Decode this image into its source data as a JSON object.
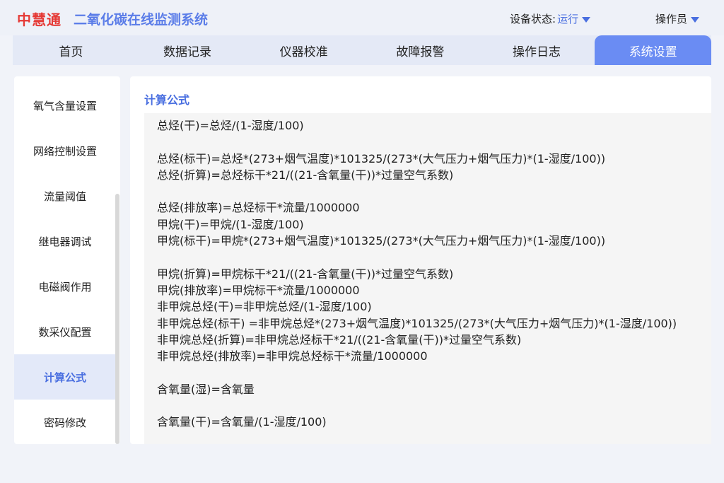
{
  "header": {
    "brand": "中慧通",
    "system_title": "二氧化碳在线监测系统",
    "status_label": "设备状态:",
    "status_value": "运行",
    "operator_label": "操作员"
  },
  "nav": {
    "tabs": [
      {
        "label": "首页"
      },
      {
        "label": "数据记录"
      },
      {
        "label": "仪器校准"
      },
      {
        "label": "故障报警"
      },
      {
        "label": "操作日志"
      },
      {
        "label": "系统设置"
      }
    ],
    "active_index": 5
  },
  "sidebar": {
    "items": [
      {
        "label": "氧气含量设置"
      },
      {
        "label": "网络控制设置"
      },
      {
        "label": "流量阈值"
      },
      {
        "label": "继电器调试"
      },
      {
        "label": "电磁阀作用"
      },
      {
        "label": "数采仪配置"
      },
      {
        "label": "计算公式"
      },
      {
        "label": "密码修改"
      }
    ],
    "active_index": 6
  },
  "main": {
    "section_title": "计算公式",
    "formulas": [
      "总烃(干)=总烃/(1-湿度/100)",
      "",
      "总烃(标干)=总烃*(273+烟气温度)*101325/(273*(大气压力+烟气压力)*(1-湿度/100))",
      "总烃(折算)=总烃标干*21/((21-含氧量(干))*过量空气系数)",
      "",
      "总烃(排放率)=总烃标干*流量/1000000",
      "甲烷(干)=甲烷/(1-湿度/100)",
      "甲烷(标干)=甲烷*(273+烟气温度)*101325/(273*(大气压力+烟气压力)*(1-湿度/100))",
      "",
      "甲烷(折算)=甲烷标干*21/((21-含氧量(干))*过量空气系数)",
      "甲烷(排放率)=甲烷标干*流量/1000000",
      "非甲烷总烃(干)=非甲烷总烃/(1-湿度/100)",
      "非甲烷总烃(标干) =非甲烷总烃*(273+烟气温度)*101325/(273*(大气压力+烟气压力)*(1-湿度/100))",
      "非甲烷总烃(折算)=非甲烷总烃标干*21/((21-含氧量(干))*过量空气系数)",
      "非甲烷总烃(排放率)=非甲烷总烃标干*流量/1000000",
      "",
      "含氧量(湿)=含氧量",
      "",
      "含氧量(干)=含氧量/(1-湿度/100)"
    ]
  },
  "colors": {
    "brand": "#e53935",
    "accent": "#4a6fe0",
    "active_tab": "#6a8cf3"
  }
}
